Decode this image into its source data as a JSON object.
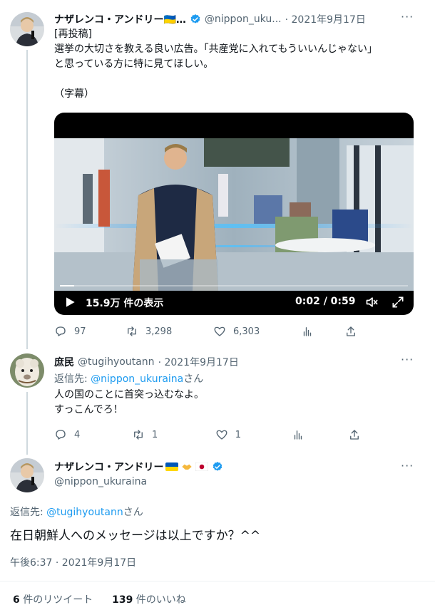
{
  "tweet1": {
    "name": "ナザレンコ・アンドリー🇺🇦…",
    "handle": "@nippon_uku...",
    "date": "· 2021年9月17日",
    "lines": [
      "[再投稿]",
      "選挙の大切さを教える良い広告。「共産党に入れてもういいんじゃない」",
      "と思っている方に特に見てほしい。",
      "",
      "（字幕）"
    ],
    "video": {
      "views": "15.9万 件の表示",
      "time": "0:02 / 0:59",
      "progress": 0.04
    },
    "actions": {
      "replies": "97",
      "retweets": "3,298",
      "likes": "6,303"
    }
  },
  "tweet2": {
    "name": "庶民",
    "handle": "@tugihyoutann",
    "date": "· 2021年9月17日",
    "reply_prefix": "返信先: ",
    "reply_to": "@nippon_ukuraina",
    "reply_suffix": "さん",
    "lines": [
      "人の国のことに首突っ込むなよ。",
      "すっこんでろ！"
    ],
    "actions": {
      "replies": "4",
      "retweets": "1",
      "likes": "1"
    }
  },
  "main_tweet": {
    "name": "ナザレンコ・アンドリー",
    "handle": "@nippon_ukuraina",
    "reply_prefix": "返信先: ",
    "reply_to": "@tugihyoutann",
    "reply_suffix": "さん",
    "text": "在日朝鮮人へのメッセージは以上ですか？^^",
    "timestamp": "午後6:37 · 2021年9月17日",
    "stats": {
      "retweets_count": "6",
      "retweets_label": " 件のリツイート",
      "likes_count": "139",
      "likes_label": " 件のいいね"
    }
  },
  "colors": {
    "accent": "#1d9bf0",
    "muted": "#536471",
    "flag_blue": "#0057b7",
    "flag_yellow": "#ffd700"
  },
  "icons": [
    "reply-icon",
    "retweet-icon",
    "like-icon",
    "views-icon",
    "share-icon",
    "play-icon",
    "volume-icon",
    "fullscreen-icon",
    "verified-icon"
  ]
}
